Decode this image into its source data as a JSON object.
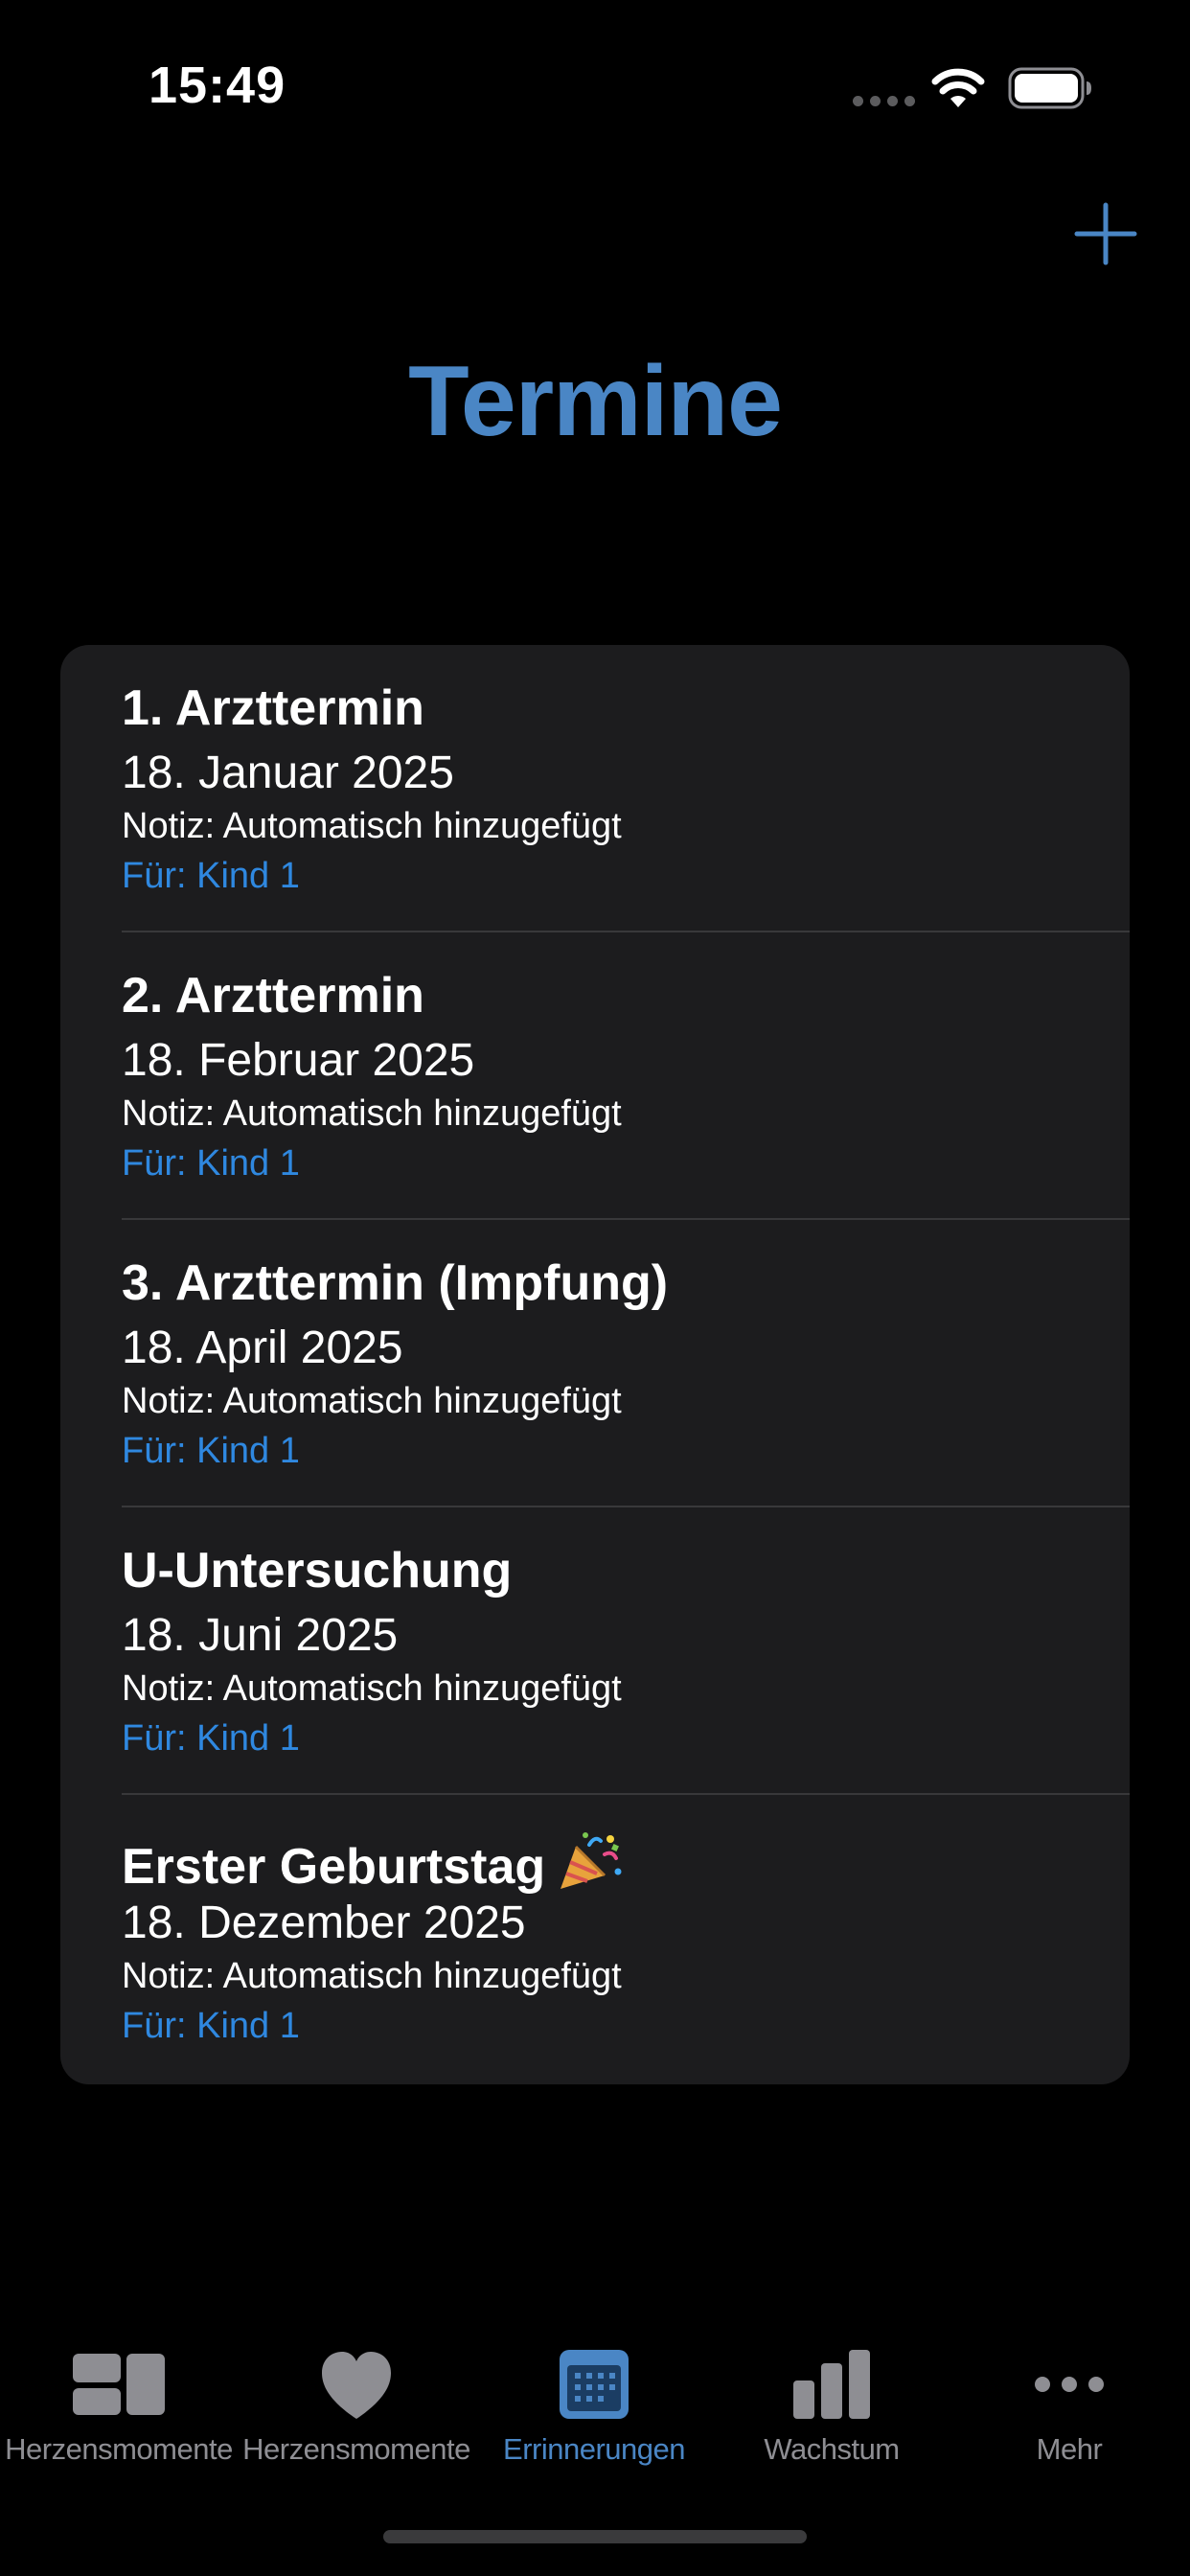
{
  "status_bar": {
    "time": "15:49"
  },
  "header": {
    "title": "Termine",
    "add_icon": "plus-icon"
  },
  "appointments": [
    {
      "title": "1. Arzttermin",
      "date": "18. Januar 2025",
      "note": "Notiz: Automatisch hinzugefügt",
      "for": "Für: Kind 1"
    },
    {
      "title": "2. Arzttermin",
      "date": "18. Februar 2025",
      "note": "Notiz: Automatisch hinzugefügt",
      "for": "Für: Kind 1"
    },
    {
      "title": "3. Arzttermin (Impfung)",
      "date": "18. April 2025",
      "note": "Notiz: Automatisch hinzugefügt",
      "for": "Für: Kind 1"
    },
    {
      "title": "U-Untersuchung",
      "date": "18. Juni 2025",
      "note": "Notiz: Automatisch hinzugefügt",
      "for": "Für: Kind 1"
    },
    {
      "title": "Erster Geburtstag",
      "title_icon": "party-popper-icon",
      "date": "18. Dezember 2025",
      "note": "Notiz: Automatisch hinzugefügt",
      "for": "Für: Kind 1"
    }
  ],
  "tab_bar": {
    "items": [
      {
        "label": "Herzensmomente",
        "icon": "dashboard-icon",
        "active": false
      },
      {
        "label": "Herzensmomente",
        "icon": "heart-icon",
        "active": false
      },
      {
        "label": "Errinnerungen",
        "icon": "calendar-icon",
        "active": true
      },
      {
        "label": "Wachstum",
        "icon": "bar-chart-icon",
        "active": false
      },
      {
        "label": "Mehr",
        "icon": "more-icon",
        "active": false
      }
    ]
  },
  "colors": {
    "background": "#000000",
    "card": "#1c1c1e",
    "accent": "#4a86c5",
    "link_blue": "#2f88e0",
    "inactive": "#8e8e93"
  }
}
